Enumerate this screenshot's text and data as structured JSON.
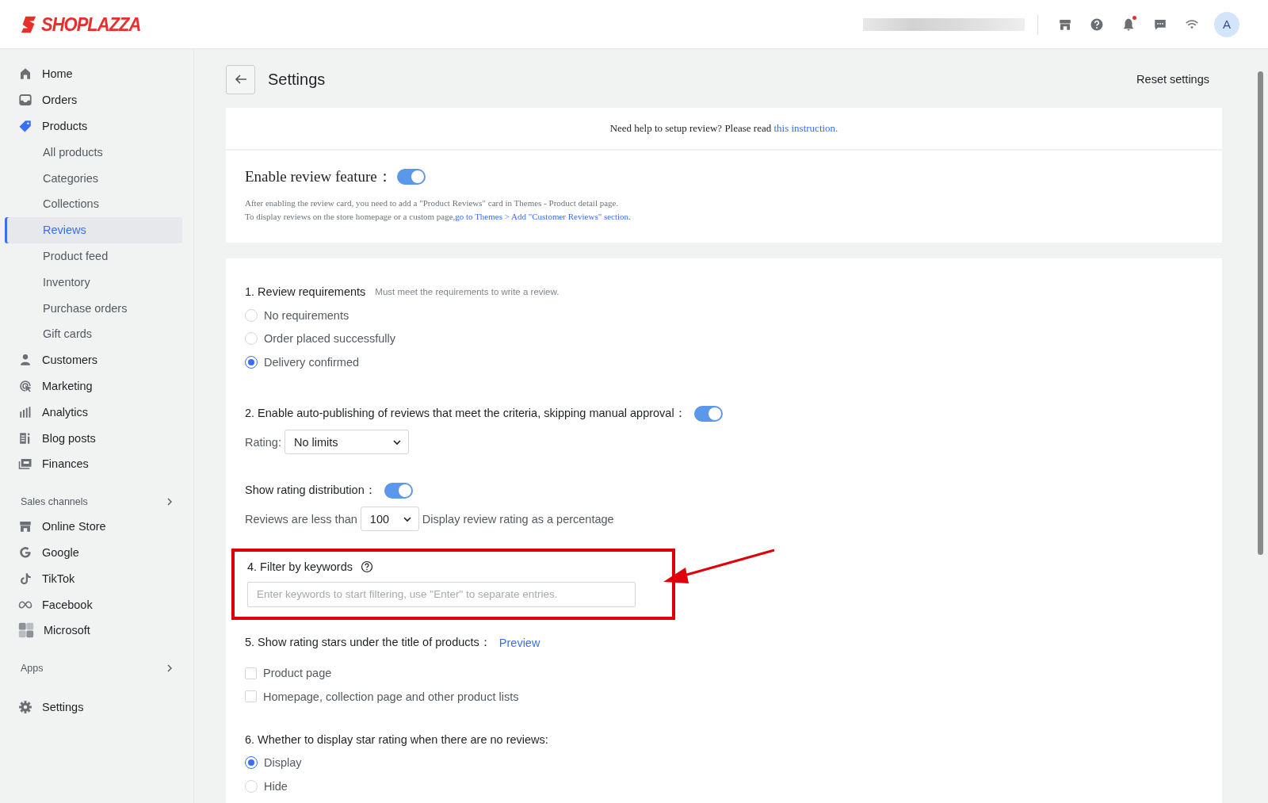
{
  "header": {
    "logo": "SHOPLAZZA",
    "avatar": "A",
    "notification": true
  },
  "sidebar": {
    "items": [
      {
        "label": "Home",
        "selected": false
      },
      {
        "label": "Orders",
        "selected": false
      },
      {
        "label": "Products",
        "selected": false,
        "expanded": true,
        "children": [
          {
            "label": "All products",
            "selected": false
          },
          {
            "label": "Categories",
            "selected": false
          },
          {
            "label": "Collections",
            "selected": false
          },
          {
            "label": "Reviews",
            "selected": true
          },
          {
            "label": "Product feed",
            "selected": false
          },
          {
            "label": "Inventory",
            "selected": false
          },
          {
            "label": "Purchase orders",
            "selected": false
          },
          {
            "label": "Gift cards",
            "selected": false
          }
        ]
      },
      {
        "label": "Customers",
        "selected": false
      },
      {
        "label": "Marketing",
        "selected": false
      },
      {
        "label": "Analytics",
        "selected": false
      },
      {
        "label": "Blog posts",
        "selected": false
      },
      {
        "label": "Finances",
        "selected": false
      }
    ],
    "sections": [
      {
        "title": "Sales channels",
        "items": [
          {
            "label": "Online Store",
            "selected": false
          },
          {
            "label": "Google",
            "selected": false
          },
          {
            "label": "TikTok",
            "selected": false
          },
          {
            "label": "Facebook",
            "selected": false
          },
          {
            "label": "Microsoft",
            "selected": false
          }
        ]
      },
      {
        "title": "Apps"
      }
    ],
    "footer_items": [
      {
        "label": "Settings",
        "selected": false
      }
    ]
  },
  "page": {
    "title": "Settings",
    "reset_link": "Reset settings"
  },
  "help_banner": {
    "text": "Need help to setup review? Please read ",
    "link": "this instruction."
  },
  "enable_card": {
    "label": "Enable review feature：",
    "on": true,
    "note_line_1": "After enabling the review card, you need to add a \"Product Reviews\" card in Themes - Product detail page.",
    "note_line_2": "To display reviews on the store homepage or a custom page,",
    "note_link": "go to Themes > Add \"Customer Reviews\" section."
  },
  "settings": [
    {
      "kind": "radio",
      "title": "1. Review requirements",
      "hint": "Must meet the requirements to write a review.",
      "options": [
        {
          "label": "No requirements",
          "selected": false
        },
        {
          "label": "Order placed successfully",
          "selected": false
        },
        {
          "label": "Delivery confirmed",
          "selected": true
        }
      ]
    },
    {
      "kind": "toggle",
      "title": "2. Enable auto-publishing of reviews that meet the criteria, skipping manual approval：",
      "on": true,
      "select": {
        "label": "Rating:",
        "value": "No limits"
      }
    },
    {
      "kind": "toggle",
      "title": "Show rating distribution：",
      "on": true,
      "select": {
        "label": "Reviews are less than",
        "value": "100",
        "suffix": "Display review rating as a percentage"
      }
    },
    {
      "kind": "keywords",
      "title": "4. Filter by keywords",
      "placeholder": "Enter keywords to start filtering, use \"Enter\" to separate entries.",
      "highlighted": true
    },
    {
      "kind": "checkbox",
      "title": "5. Show rating stars under the title of products：",
      "link": "Preview",
      "options": [
        {
          "label": "Product page",
          "checked": false
        },
        {
          "label": "Homepage, collection page and other product lists",
          "checked": false
        }
      ]
    },
    {
      "kind": "radio",
      "title": "6. Whether to display star rating when there are no reviews:",
      "options": [
        {
          "label": "Display",
          "selected": true
        },
        {
          "label": "Hide",
          "selected": false
        }
      ]
    }
  ]
}
